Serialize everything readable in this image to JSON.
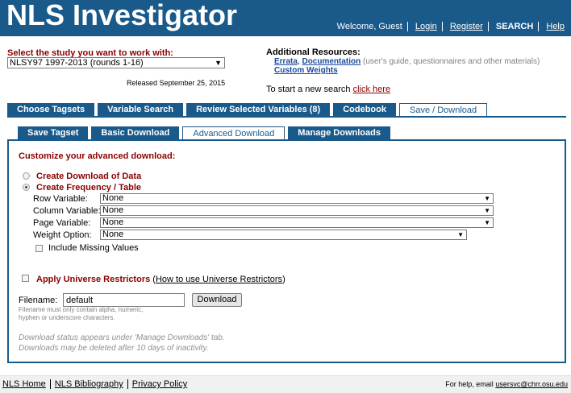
{
  "header": {
    "logo": "NLS Investigator",
    "welcome": "Welcome, Guest",
    "nav": [
      "Login",
      "Register",
      "SEARCH",
      "Help"
    ]
  },
  "study": {
    "label": "Select the study you want to work with:",
    "selected": "NLSY97 1997-2013 (rounds 1-16)",
    "released": "Released September 25, 2015"
  },
  "resources": {
    "title": "Additional Resources:",
    "errata": "Errata",
    "documentation": "Documentation",
    "doc_note": " (user's guide, questionnaires and other materials)",
    "custom_weights": "Custom Weights",
    "new_search_prefix": "To start a new search ",
    "new_search_link": "click here"
  },
  "main_tabs": [
    {
      "label": "Choose Tagsets",
      "active": false
    },
    {
      "label": "Variable Search",
      "active": false
    },
    {
      "label": "Review Selected Variables (8)",
      "active": false
    },
    {
      "label": "Codebook",
      "active": false
    },
    {
      "label": "Save / Download",
      "active": true
    }
  ],
  "sub_tabs": [
    {
      "label": "Save Tagset",
      "active": false
    },
    {
      "label": "Basic Download",
      "active": false
    },
    {
      "label": "Advanced Download",
      "active": true
    },
    {
      "label": "Manage Downloads",
      "active": false
    }
  ],
  "panel": {
    "title": "Customize your advanced download:",
    "option_data": "Create Download of Data",
    "option_freq": "Create Frequency / Table",
    "row_label": "Row Variable:",
    "row_value": "None",
    "col_label": "Column Variable:",
    "col_value": "None",
    "page_label": "Page Variable:",
    "page_value": "None",
    "weight_label": "Weight Option:",
    "weight_value": "None",
    "include_missing": "Include Missing Values",
    "restrict_label": "Apply Universe Restrictors",
    "restrict_help": "How to use Universe Restrictors",
    "filename_label": "Filename:",
    "filename_value": "default",
    "download_button": "Download",
    "filename_hint": "Filename must only contain alpha, numeric, hyphen or underscore characters.",
    "status_line1": "Download status appears under 'Manage Downloads' tab.",
    "status_line2": "Downloads may be deleted after 10 days of inactivity."
  },
  "footer": {
    "links": [
      "NLS Home",
      "NLS Bibliography",
      "Privacy Policy"
    ],
    "help_prefix": "For help, email ",
    "help_email": "usersvc@chrr.osu.edu"
  }
}
